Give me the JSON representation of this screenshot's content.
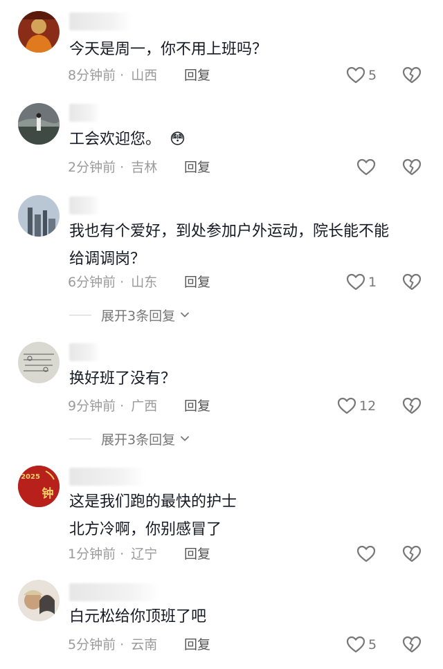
{
  "comments": [
    {
      "text": "今天是周一，你不用上班吗？",
      "time": "8分钟前",
      "dot": "·",
      "location": "山西",
      "reply": "回复",
      "likes": "5"
    },
    {
      "text": "工会欢迎您。",
      "emoji": "😳",
      "time": "2分钟前",
      "dot": "·",
      "location": "吉林",
      "reply": "回复",
      "likes": ""
    },
    {
      "text_line1": "我也有个爱好，到处参加户外运动，院长能不能",
      "text_line2": "给调调岗？",
      "time": "6分钟前",
      "dot": "·",
      "location": "山东",
      "reply": "回复",
      "likes": "1",
      "expand": "展开3条回复"
    },
    {
      "text": "换好班了没有？",
      "time": "9分钟前",
      "dot": "·",
      "location": "广西",
      "reply": "回复",
      "likes": "12",
      "expand": "展开3条回复"
    },
    {
      "text_line1": "这是我们跑的最快的护士",
      "text_line2": "北方冷啊，你别感冒了",
      "time": "1分钟前",
      "dot": "·",
      "location": "辽宁",
      "reply": "回复",
      "likes": "",
      "avatar_text_top": "2025",
      "avatar_text_main": "钟"
    },
    {
      "text": "白元松给你顶班了吧",
      "time": "5分钟前",
      "dot": "·",
      "location": "云南",
      "reply": "回复",
      "likes": "5"
    }
  ],
  "icons": {
    "like": "heart-outline-icon",
    "dislike": "broken-heart-icon",
    "chevron": "chevron-down-icon"
  },
  "colors": {
    "text": "#161823",
    "meta": "#9a9a9a",
    "icon": "#777777",
    "avatar5_bg": "#b8201c"
  }
}
